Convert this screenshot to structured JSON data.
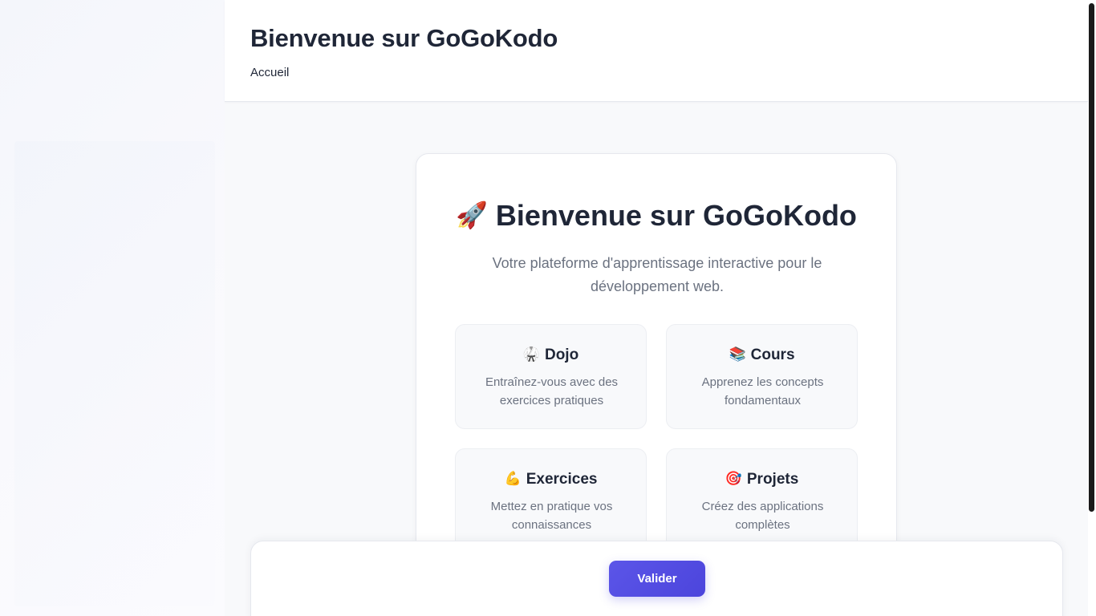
{
  "header": {
    "title": "Bienvenue sur GoGoKodo",
    "breadcrumb": "Accueil"
  },
  "welcome": {
    "icon": "🚀",
    "icon_name": "rocket-icon",
    "title": "Bienvenue sur GoGoKodo",
    "subtitle": "Votre plateforme d'apprentissage interactive pour le développement web."
  },
  "features": [
    {
      "icon": "🥋",
      "icon_name": "martial-arts-uniform-icon",
      "title": "Dojo",
      "description": "Entraînez-vous avec des exercices pratiques"
    },
    {
      "icon": "📚",
      "icon_name": "books-icon",
      "title": "Cours",
      "description": "Apprenez les concepts fondamentaux"
    },
    {
      "icon": "💪",
      "icon_name": "flexed-biceps-icon",
      "title": "Exercices",
      "description": "Mettez en pratique vos connaissances"
    },
    {
      "icon": "🎯",
      "icon_name": "target-icon",
      "title": "Projets",
      "description": "Créez des applications complètes"
    }
  ],
  "actions": {
    "validate_label": "Valider"
  },
  "colors": {
    "accent": "#4f46e5",
    "text_primary": "#1f2637",
    "text_secondary": "#6b7280",
    "background": "#f8f9fb"
  }
}
